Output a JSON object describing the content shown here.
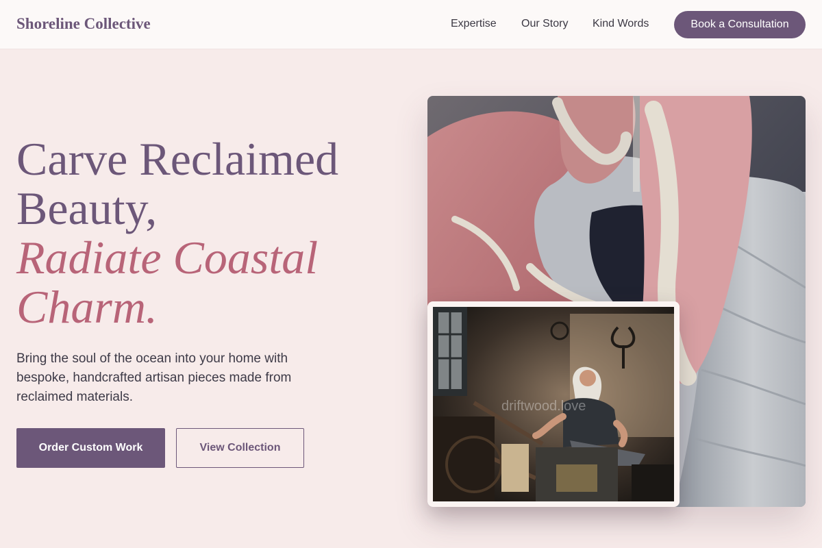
{
  "header": {
    "brand": "Shoreline Collective",
    "nav": [
      "Expertise",
      "Our Story",
      "Kind Words"
    ],
    "cta": "Book a Consultation"
  },
  "hero": {
    "title_lines": [
      "Carve Reclaimed",
      "Beauty,"
    ],
    "accent_lines": [
      "Radiate Coastal",
      "Charm."
    ],
    "description": "Bring the soul of the ocean into your home with bespoke, handcrafted artisan pieces made from reclaimed materials.",
    "primary_button": "Order Custom Work",
    "secondary_button": "View Collection"
  },
  "images": {
    "main": "pottery-wheel-hands-photo",
    "inset": "blacksmith-workshop-photo",
    "watermark": "driftwood.love"
  },
  "colors": {
    "brand": "#6c5779",
    "accent": "#b86478",
    "background": "#f7ebea",
    "header": "#fcf9f8"
  }
}
